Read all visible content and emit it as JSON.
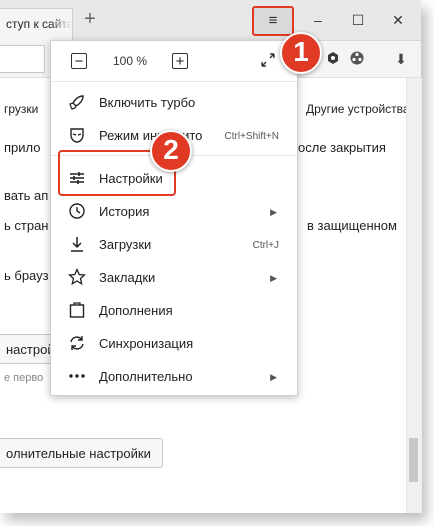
{
  "tab": {
    "title": "ступ к сайта"
  },
  "toolbar": {
    "new_tab": "+",
    "menu": "≡",
    "minimize": "–",
    "maximize": "☐",
    "close": "✕",
    "download": "⬇"
  },
  "page": {
    "line_downloads": "грузки",
    "line_devices": "Другие устройства",
    "line_1": "прило",
    "line_1b": "осле закрытия",
    "line_2": "вать ап",
    "line_3": "ь стран",
    "line_3b": "в защищенном",
    "line_4": "ь брауз",
    "btn_settings": "настрой",
    "line_first": "е перво",
    "btn_advanced": "олнительные настройки"
  },
  "menu": {
    "zoom": {
      "minus": "−",
      "value": "100 %",
      "plus": "+"
    },
    "items": [
      {
        "label": "Включить турбо",
        "shortcut": "",
        "arrow": ""
      },
      {
        "label": "Режим инкогнито",
        "shortcut": "Ctrl+Shift+N",
        "arrow": ""
      },
      {
        "label": "Настройки",
        "shortcut": "",
        "arrow": ""
      },
      {
        "label": "История",
        "shortcut": "",
        "arrow": "▶"
      },
      {
        "label": "Загрузки",
        "shortcut": "Ctrl+J",
        "arrow": ""
      },
      {
        "label": "Закладки",
        "shortcut": "",
        "arrow": "▶"
      },
      {
        "label": "Дополнения",
        "shortcut": "",
        "arrow": ""
      },
      {
        "label": "Синхронизация",
        "shortcut": "",
        "arrow": ""
      },
      {
        "label": "Дополнительно",
        "shortcut": "",
        "arrow": "▶"
      }
    ]
  },
  "badges": {
    "one": "1",
    "two": "2"
  },
  "colors": {
    "accent": "#e03a24"
  }
}
